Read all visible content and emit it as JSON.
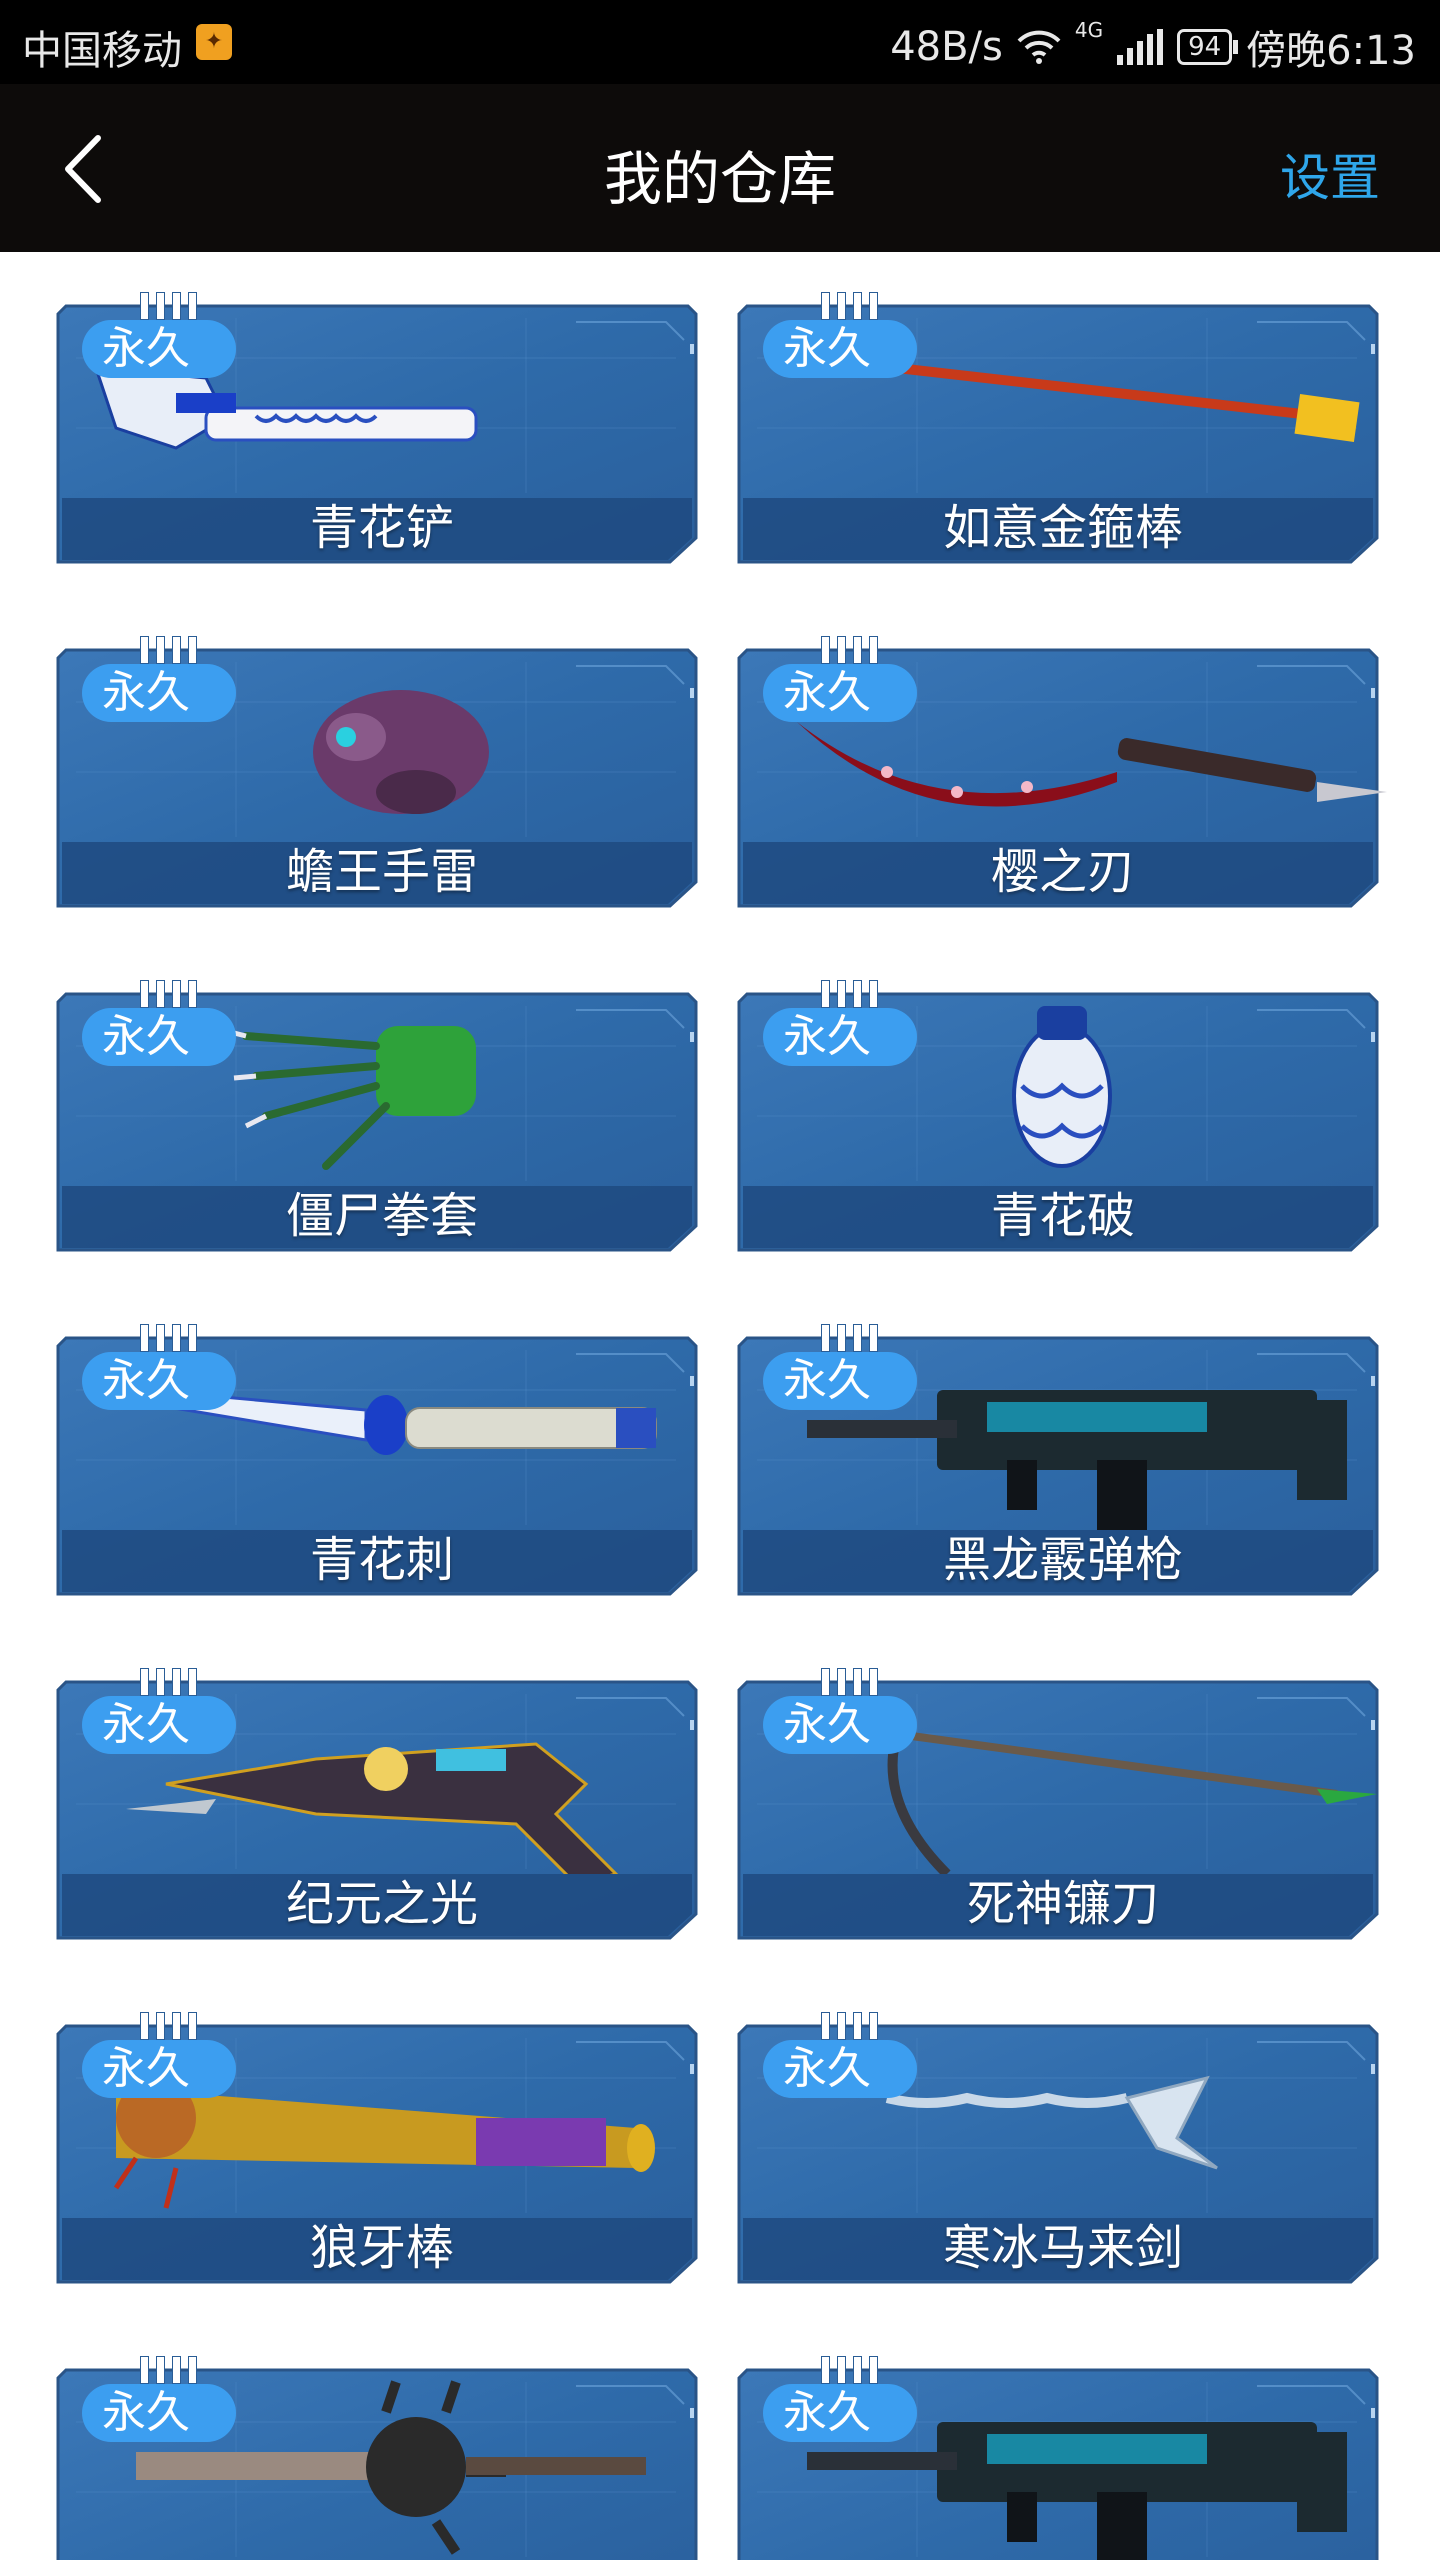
{
  "status_bar": {
    "carrier": "中国移动",
    "net_speed": "48B/s",
    "network_type": "4G",
    "battery": "94",
    "time": "傍晚6:13"
  },
  "header": {
    "title": "我的仓库",
    "settings_label": "设置",
    "back_icon": "chevron-left-icon"
  },
  "items": [
    {
      "badge": "永久",
      "name": "青花铲",
      "icon": "blue-porcelain-shovel"
    },
    {
      "badge": "永久",
      "name": "如意金箍棒",
      "icon": "golden-staff"
    },
    {
      "badge": "永久",
      "name": "蟾王手雷",
      "icon": "toad-grenade"
    },
    {
      "badge": "永久",
      "name": "樱之刃",
      "icon": "sakura-blade"
    },
    {
      "badge": "永久",
      "name": "僵尸拳套",
      "icon": "zombie-claw-glove"
    },
    {
      "badge": "永久",
      "name": "青花破",
      "icon": "porcelain-grenade"
    },
    {
      "badge": "永久",
      "name": "青花刺",
      "icon": "porcelain-dagger"
    },
    {
      "badge": "永久",
      "name": "黑龙霰弹枪",
      "icon": "black-dragon-shotgun"
    },
    {
      "badge": "永久",
      "name": "纪元之光",
      "icon": "epoch-light-gun"
    },
    {
      "badge": "永久",
      "name": "死神镰刀",
      "icon": "reaper-scythe"
    },
    {
      "badge": "永久",
      "name": "狼牙棒",
      "icon": "spiked-bat"
    },
    {
      "badge": "永久",
      "name": "寒冰马来剑",
      "icon": "ice-kris-sword"
    },
    {
      "badge": "永久",
      "name": "",
      "icon": "spiked-mace"
    },
    {
      "badge": "永久",
      "name": "",
      "icon": "black-dragon-shotgun"
    }
  ]
}
